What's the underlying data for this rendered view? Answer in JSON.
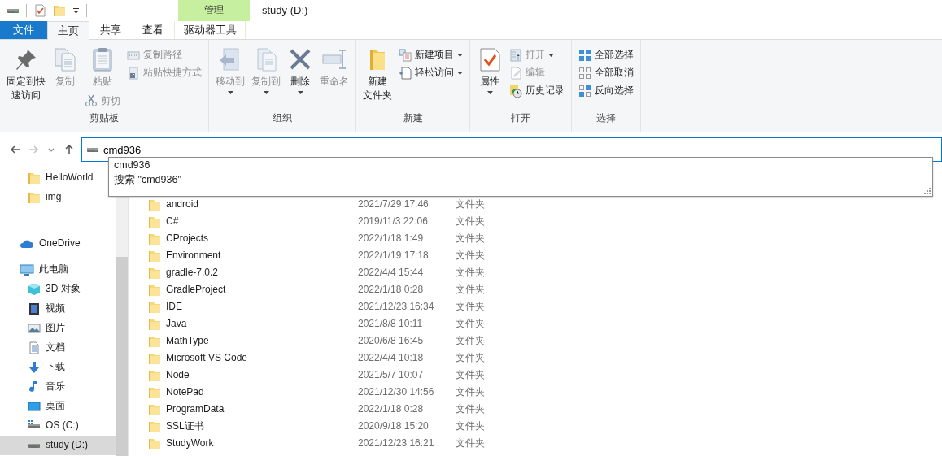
{
  "window": {
    "title": "study (D:)"
  },
  "context_tab": {
    "group": "管理"
  },
  "tabs": [
    {
      "label": "文件",
      "kind": "file",
      "selected": false
    },
    {
      "label": "主页",
      "kind": "normal",
      "selected": true
    },
    {
      "label": "共享",
      "kind": "normal",
      "selected": false
    },
    {
      "label": "查看",
      "kind": "normal",
      "selected": false
    },
    {
      "label": "驱动器工具",
      "kind": "context",
      "selected": false
    }
  ],
  "ribbon": {
    "groups": [
      {
        "label": "剪贴板",
        "buttons": [
          {
            "lines": [
              "固定到快",
              "速访问"
            ],
            "kind": "large",
            "disabled": false,
            "dropdown": false
          },
          {
            "lines": [
              "复制"
            ],
            "kind": "large",
            "disabled": true,
            "dropdown": false
          },
          {
            "lines": [
              "粘贴"
            ],
            "kind": "large",
            "disabled": true,
            "dropdown": false
          },
          {
            "label": "剪切",
            "kind": "stacked",
            "disabled": true,
            "dropdown": false
          },
          {
            "label": "复制路径",
            "kind": "small",
            "disabled": true,
            "dropdown": false
          },
          {
            "label": "粘贴快捷方式",
            "kind": "small",
            "disabled": true,
            "dropdown": false
          }
        ]
      },
      {
        "label": "组织",
        "buttons": [
          {
            "lines": [
              "移动到"
            ],
            "kind": "large",
            "disabled": true,
            "dropdown": true
          },
          {
            "lines": [
              "复制到"
            ],
            "kind": "large",
            "disabled": true,
            "dropdown": true
          },
          {
            "lines": [
              "删除"
            ],
            "kind": "large",
            "disabled": false,
            "dropdown": true
          },
          {
            "lines": [
              "重命名"
            ],
            "kind": "large",
            "disabled": true,
            "dropdown": false
          }
        ]
      },
      {
        "label": "新建",
        "buttons": [
          {
            "lines": [
              "新建",
              "文件夹"
            ],
            "kind": "large",
            "disabled": false,
            "dropdown": false
          },
          {
            "label": "新建项目",
            "kind": "small",
            "disabled": false,
            "dropdown": true
          },
          {
            "label": "轻松访问",
            "kind": "small",
            "disabled": false,
            "dropdown": true
          }
        ]
      },
      {
        "label": "打开",
        "buttons": [
          {
            "lines": [
              "属性"
            ],
            "kind": "large",
            "disabled": false,
            "dropdown": true
          },
          {
            "label": "打开",
            "kind": "small",
            "disabled": true,
            "dropdown": true
          },
          {
            "label": "编辑",
            "kind": "small",
            "disabled": true,
            "dropdown": false
          },
          {
            "label": "历史记录",
            "kind": "small",
            "disabled": false,
            "dropdown": false
          }
        ]
      },
      {
        "label": "选择",
        "buttons": [
          {
            "label": "全部选择",
            "kind": "small",
            "disabled": false,
            "dropdown": false
          },
          {
            "label": "全部取消",
            "kind": "small",
            "disabled": false,
            "dropdown": false
          },
          {
            "label": "反向选择",
            "kind": "small",
            "disabled": false,
            "dropdown": false
          }
        ]
      }
    ]
  },
  "nav_buttons": [
    {
      "kind": "back",
      "disabled": false
    },
    {
      "kind": "forward",
      "disabled": true
    },
    {
      "kind": "recent",
      "disabled": false
    },
    {
      "kind": "up",
      "disabled": false
    }
  ],
  "address_bar": {
    "value": "cmd936"
  },
  "suggestions": [
    "cmd936",
    "搜索 \"cmd936\""
  ],
  "quick_access_items": [
    {
      "label": "HelloWorld",
      "selected": false
    },
    {
      "label": "img",
      "selected": false
    }
  ],
  "nav": [
    {
      "label": "OneDrive",
      "selected": false
    },
    {
      "label": "此电脑",
      "selected": false,
      "children": [
        {
          "label": "3D 对象",
          "selected": false
        },
        {
          "label": "视频",
          "selected": false
        },
        {
          "label": "图片",
          "selected": false
        },
        {
          "label": "文档",
          "selected": false
        },
        {
          "label": "下载",
          "selected": false
        },
        {
          "label": "音乐",
          "selected": false
        },
        {
          "label": "桌面",
          "selected": false
        },
        {
          "label": "OS (C:)",
          "selected": false
        },
        {
          "label": "study (D:)",
          "selected": true
        }
      ]
    }
  ],
  "files": [
    {
      "name": "android",
      "modified": "2021/7/29 17:46",
      "type": "文件夹"
    },
    {
      "name": "C#",
      "modified": "2019/11/3 22:06",
      "type": "文件夹"
    },
    {
      "name": "CProjects",
      "modified": "2022/1/18 1:49",
      "type": "文件夹"
    },
    {
      "name": "Environment",
      "modified": "2022/1/19 17:18",
      "type": "文件夹"
    },
    {
      "name": "gradle-7.0.2",
      "modified": "2022/4/4 15:44",
      "type": "文件夹"
    },
    {
      "name": "GradleProject",
      "modified": "2022/1/18 0:28",
      "type": "文件夹"
    },
    {
      "name": "IDE",
      "modified": "2021/12/23 16:34",
      "type": "文件夹"
    },
    {
      "name": "Java",
      "modified": "2021/8/8 10:11",
      "type": "文件夹"
    },
    {
      "name": "MathType",
      "modified": "2020/6/8 16:45",
      "type": "文件夹"
    },
    {
      "name": "Microsoft VS Code",
      "modified": "2022/4/4 10:18",
      "type": "文件夹"
    },
    {
      "name": "Node",
      "modified": "2021/5/7 10:07",
      "type": "文件夹"
    },
    {
      "name": "NotePad",
      "modified": "2021/12/30 14:56",
      "type": "文件夹"
    },
    {
      "name": "ProgramData",
      "modified": "2022/1/18 0:28",
      "type": "文件夹"
    },
    {
      "name": "SSL证书",
      "modified": "2020/9/18 15:20",
      "type": "文件夹"
    },
    {
      "name": "StudyWork",
      "modified": "2021/12/23 16:21",
      "type": "文件夹"
    }
  ]
}
